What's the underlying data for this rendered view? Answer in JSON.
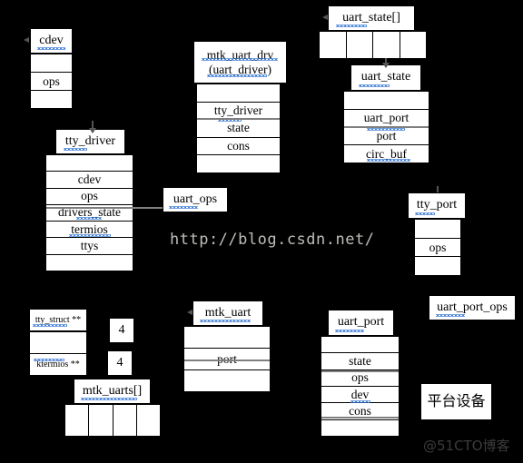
{
  "diagram": {
    "title": "Linux tty / uart driver structure relationship diagram",
    "background_color": "#000000",
    "box_fill": "#ffffff",
    "box_stroke": "#000000",
    "connector_color": "#7f7f7f",
    "spellcheck_underline_color": "#3a7bd5"
  },
  "watermarks": {
    "center": "http://blog.csdn.net/",
    "corner": "@51CTO博客"
  },
  "classes": {
    "cdev": {
      "title": "cdev",
      "fields": [
        "",
        "ops",
        ""
      ]
    },
    "tty_driver": {
      "title": "tty_driver",
      "fields": [
        "",
        "cdev",
        "ops",
        "drivers_state",
        "termios",
        "ttys",
        ""
      ]
    },
    "mtk_uart_drv": {
      "title": "mtk_uart_drv\n(uart_driver)",
      "title_line1": "mtk_uart_drv",
      "title_line2": "(uart_driver)",
      "fields": [
        "",
        "tty_driver",
        "state",
        "cons",
        ""
      ]
    },
    "uart_state_array": {
      "title": "uart_state[]",
      "cell_count": 4
    },
    "uart_state": {
      "title": "uart_state",
      "fields": [
        "",
        "uart_port",
        "port",
        "circ_buf"
      ]
    },
    "uart_ops": {
      "title": "uart_ops"
    },
    "tty_port": {
      "title": "tty_port",
      "fields": [
        "",
        "ops",
        ""
      ]
    },
    "tty_struct_pp": {
      "title": "tty_struct **",
      "fields": [
        "",
        "ktermios **"
      ]
    },
    "count_boxes": [
      "4",
      "4"
    ],
    "mtk_uarts_array": {
      "title": "mtk_uarts[]",
      "cell_count": 4
    },
    "mtk_uart": {
      "title": "mtk_uart",
      "fields": [
        "",
        "port",
        ""
      ]
    },
    "uart_port": {
      "title": "uart_port",
      "fields": [
        "",
        "state",
        "ops",
        "dev",
        "cons",
        ""
      ]
    },
    "uart_port_ops": {
      "title": "uart_port_ops"
    },
    "platform_device": {
      "title": "平台设备"
    }
  }
}
